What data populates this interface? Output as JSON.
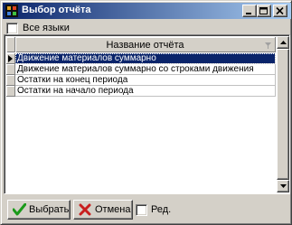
{
  "window": {
    "title": "Выбор отчёта",
    "colors": {
      "title_bar_start": "#0a246a",
      "title_bar_end": "#a6caf0",
      "face": "#d4d0c8",
      "selection": "#0a246a"
    },
    "title_icons": [
      "app-icon",
      "minimize-icon",
      "maximize-icon",
      "close-icon"
    ]
  },
  "filters": {
    "all_languages_label": "Все языки",
    "all_languages_checked": false
  },
  "grid": {
    "column_header": "Название отчёта",
    "rows": [
      {
        "label": "Движение материалов суммарно",
        "selected": true
      },
      {
        "label": "Движение материалов суммарно со строками движения",
        "selected": false
      },
      {
        "label": "Остатки на конец периода",
        "selected": false
      },
      {
        "label": "Остатки на начало периода",
        "selected": false
      }
    ]
  },
  "footer": {
    "choose_label": "Выбрать",
    "cancel_label": "Отмена",
    "edit_label": "Ред.",
    "edit_checked": false,
    "choose_icon": "check-icon",
    "cancel_icon": "cross-icon"
  }
}
